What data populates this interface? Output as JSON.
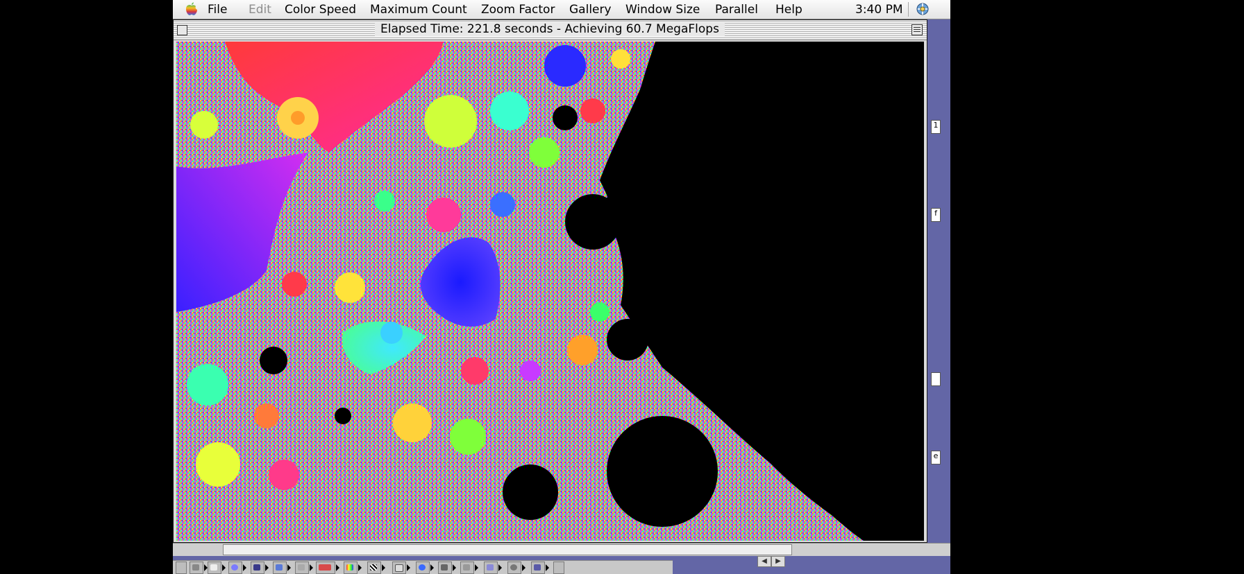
{
  "menubar": {
    "items": [
      {
        "label": "File",
        "enabled": true
      },
      {
        "label": "Edit",
        "enabled": false
      },
      {
        "label": "Color Speed",
        "enabled": true
      },
      {
        "label": "Maximum Count",
        "enabled": true
      },
      {
        "label": "Zoom Factor",
        "enabled": true
      },
      {
        "label": "Gallery",
        "enabled": true
      },
      {
        "label": "Window Size",
        "enabled": true
      },
      {
        "label": "Parallel",
        "enabled": true
      },
      {
        "label": "Help",
        "enabled": true
      }
    ],
    "clock": "3:40 PM",
    "apple_icon": "apple-logo-icon",
    "app_icon": "application-switcher-icon"
  },
  "window": {
    "title": "Elapsed Time: 221.8 seconds - Achieving 60.7 MegaFlops",
    "content": "fractal-image"
  },
  "desktop": {
    "background_color": "#6366a6",
    "fragments": [
      "1",
      "f",
      "",
      "e"
    ]
  },
  "colors": {
    "menubar": "#ececec",
    "window_frame": "#dcdcdc",
    "desktop": "#6366a6"
  }
}
